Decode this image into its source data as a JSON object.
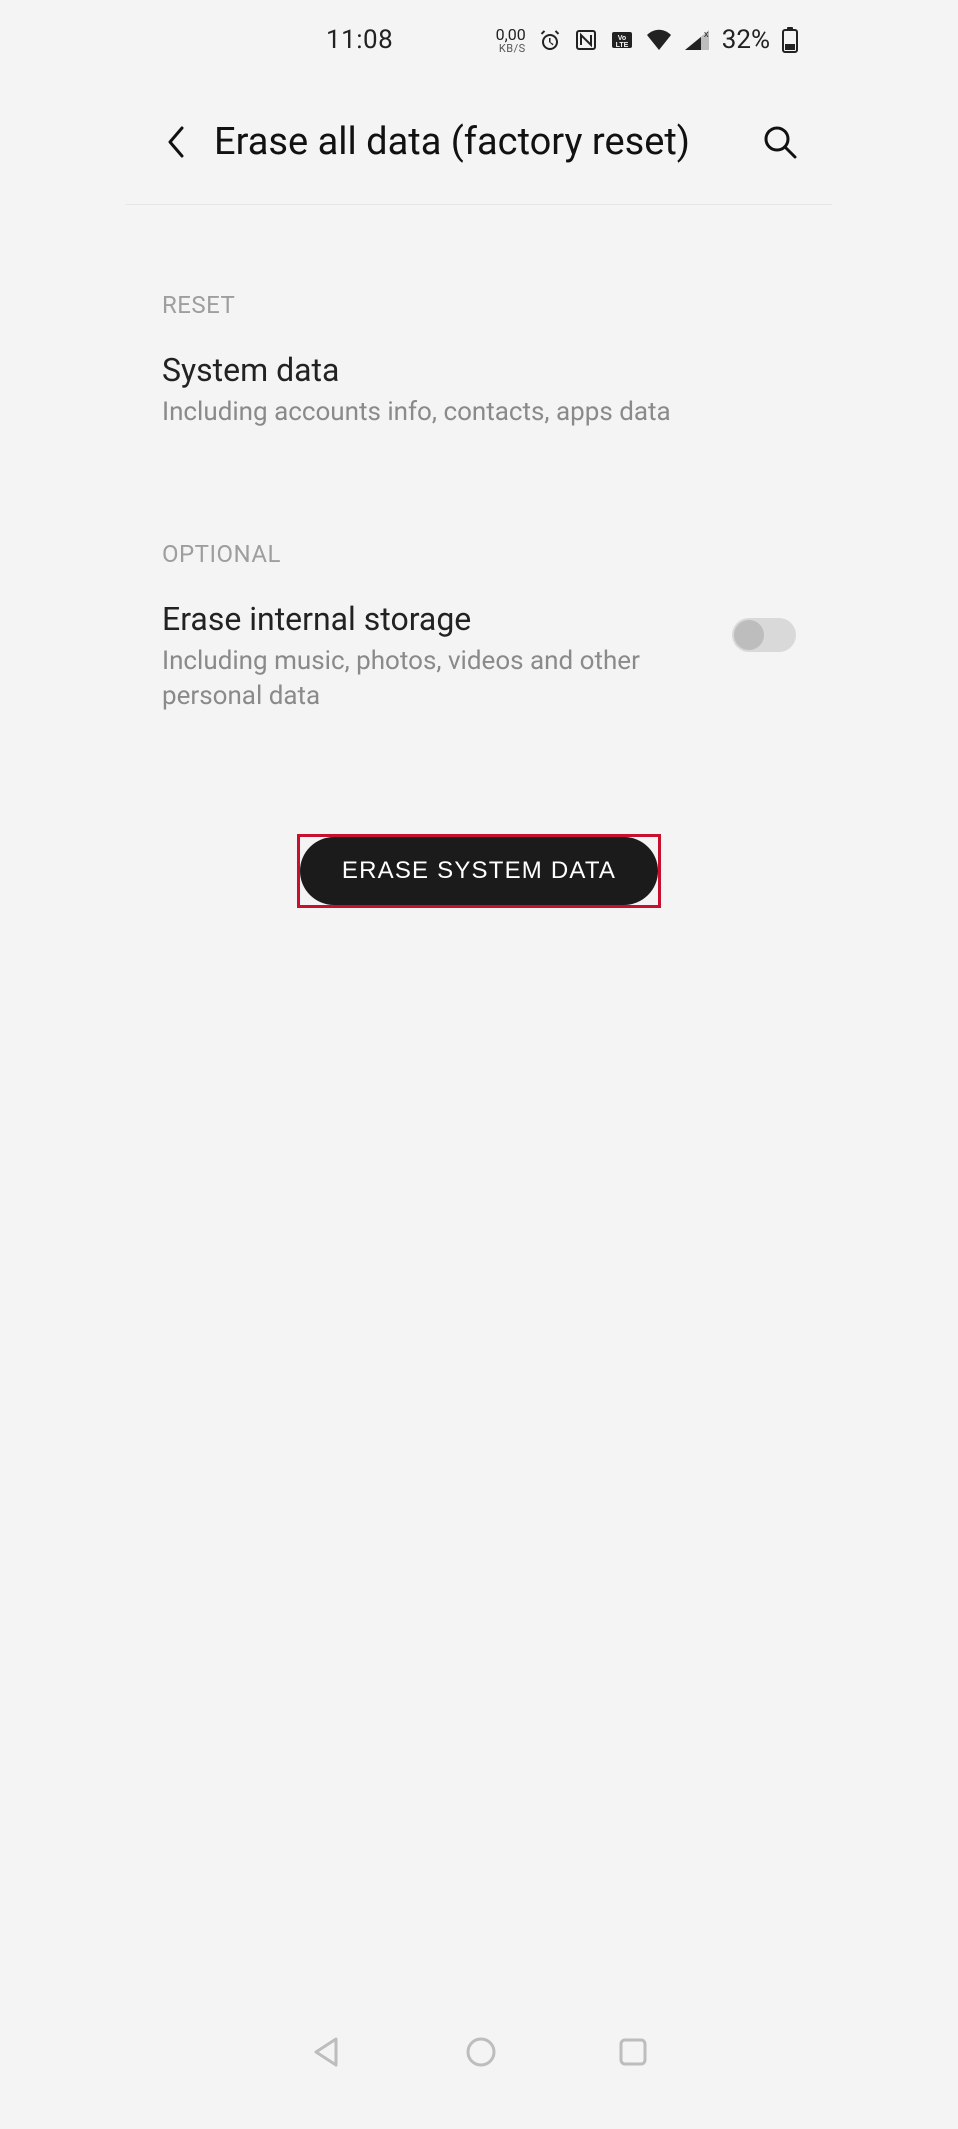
{
  "statusbar": {
    "time": "11:08",
    "net_speed": "0,00",
    "net_unit": "KB/S",
    "battery_percent": "32%"
  },
  "header": {
    "title": "Erase all data (factory reset)"
  },
  "sections": {
    "reset": {
      "label": "RESET",
      "item": {
        "title": "System data",
        "sub": "Including accounts info, contacts, apps data"
      }
    },
    "optional": {
      "label": "OPTIONAL",
      "item": {
        "title": "Erase internal storage",
        "sub": "Including music, photos, videos and other personal data",
        "toggle_on": false
      }
    }
  },
  "button": {
    "label": "ERASE SYSTEM DATA"
  }
}
